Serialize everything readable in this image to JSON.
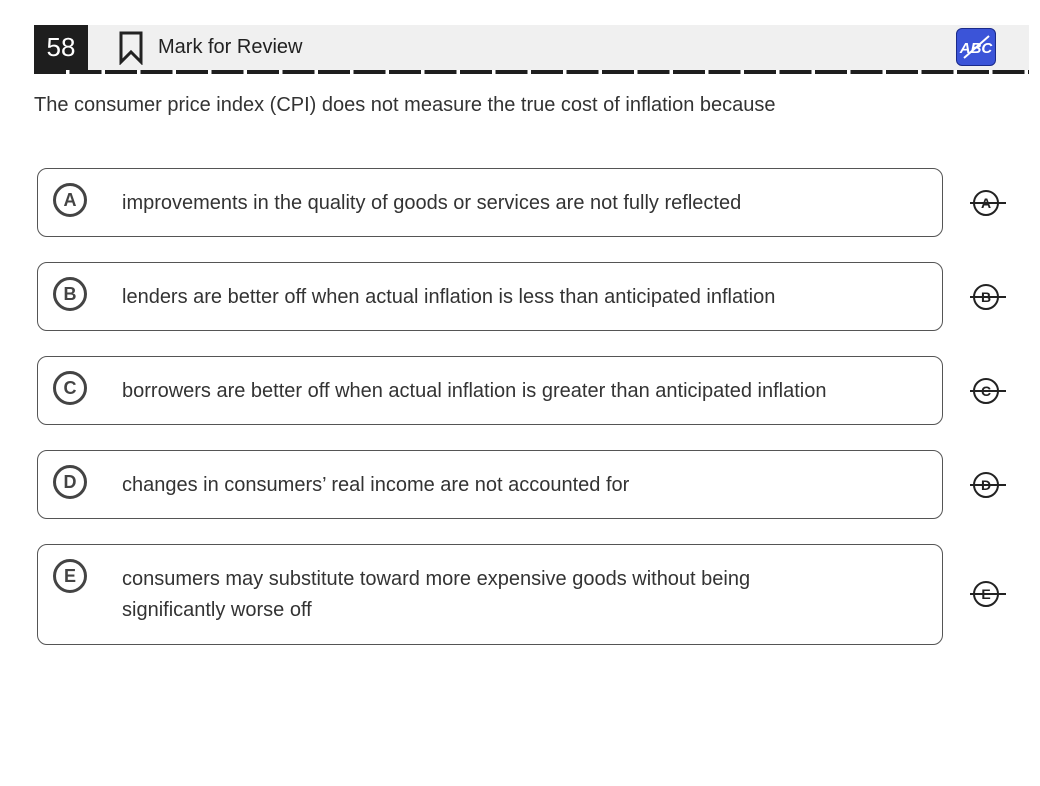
{
  "header": {
    "question_number": "58",
    "mark_label": "Mark for Review",
    "abc_icon": "abc-strikethrough-icon",
    "accent_color": "#3b54d8"
  },
  "question": {
    "text": "The consumer price index (CPI) does not measure the true cost of inflation because"
  },
  "choices": [
    {
      "letter": "A",
      "text": "improvements in the quality of goods or services are not fully reflected"
    },
    {
      "letter": "B",
      "text": "lenders are better off when actual inflation is less than anticipated inflation"
    },
    {
      "letter": "C",
      "text": "borrowers are better off when actual inflation is greater than anticipated inflation"
    },
    {
      "letter": "D",
      "text": "changes in consumers’ real income are not accounted for"
    },
    {
      "letter": "E",
      "text": "consumers may substitute toward more expensive goods without being significantly worse off"
    }
  ]
}
